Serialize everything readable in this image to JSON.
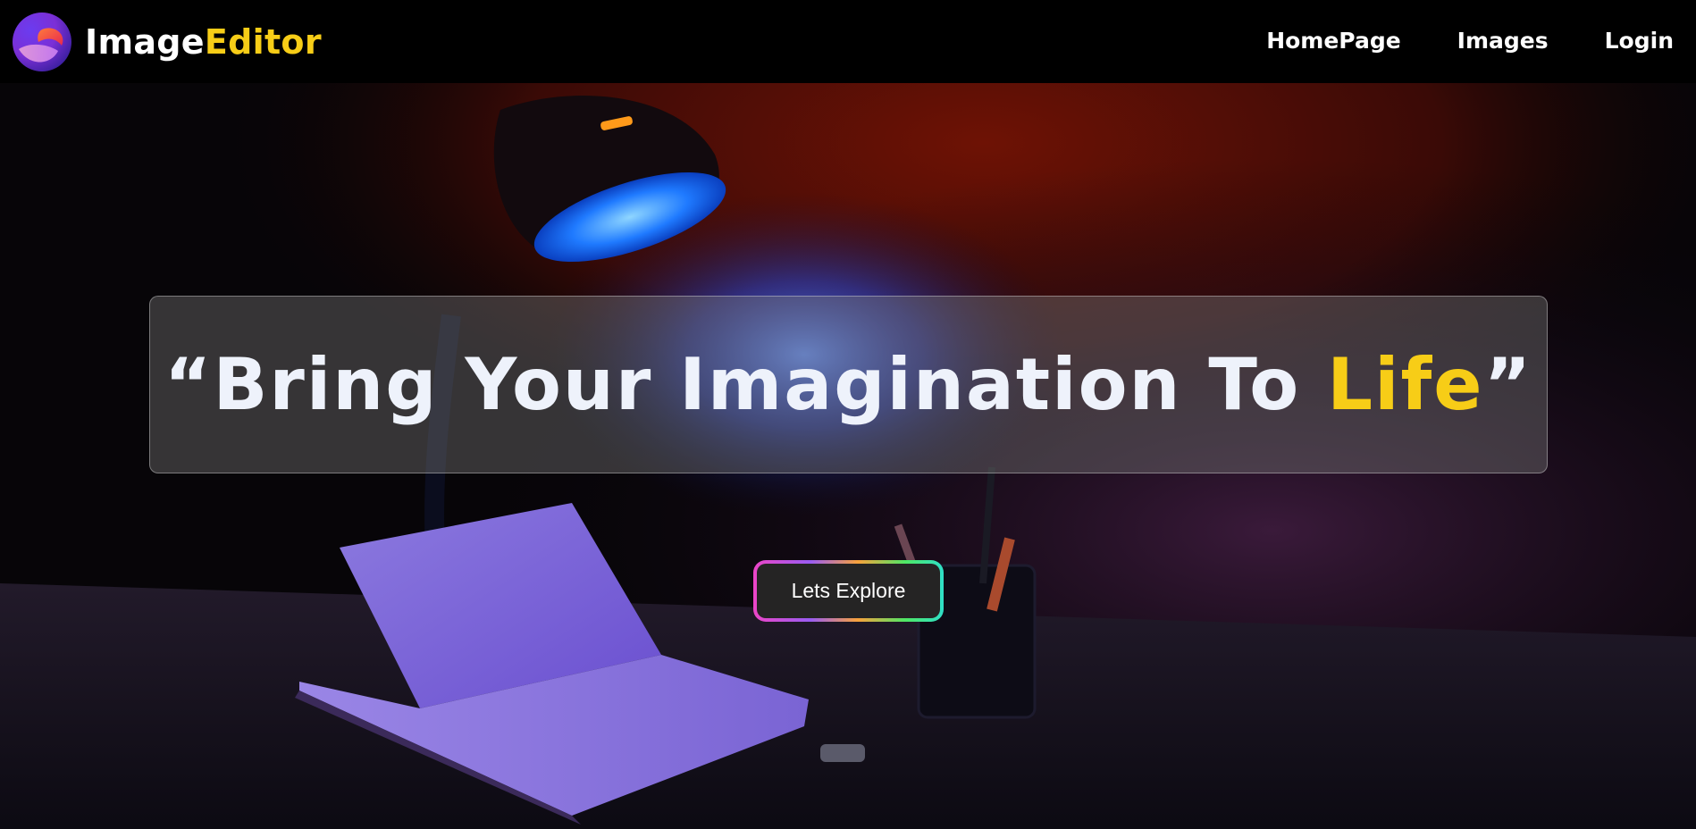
{
  "navbar": {
    "brand_main": "Image",
    "brand_accent": "Editor",
    "logo_icon": "gradient-orb-logo-icon",
    "links": [
      {
        "label": "HomePage"
      },
      {
        "label": "Images"
      },
      {
        "label": "Login"
      }
    ]
  },
  "hero": {
    "background": "dark-desk-with-blue-lamp-notebook-pen-holder",
    "quote_open": "“",
    "quote_main": "Bring Your Imagination To ",
    "quote_accent": "Life",
    "quote_close": "”",
    "cta_label": "Lets Explore"
  },
  "colors": {
    "accent": "#f7cd17",
    "nav_bg": "#000000",
    "button_bg": "#252424"
  }
}
